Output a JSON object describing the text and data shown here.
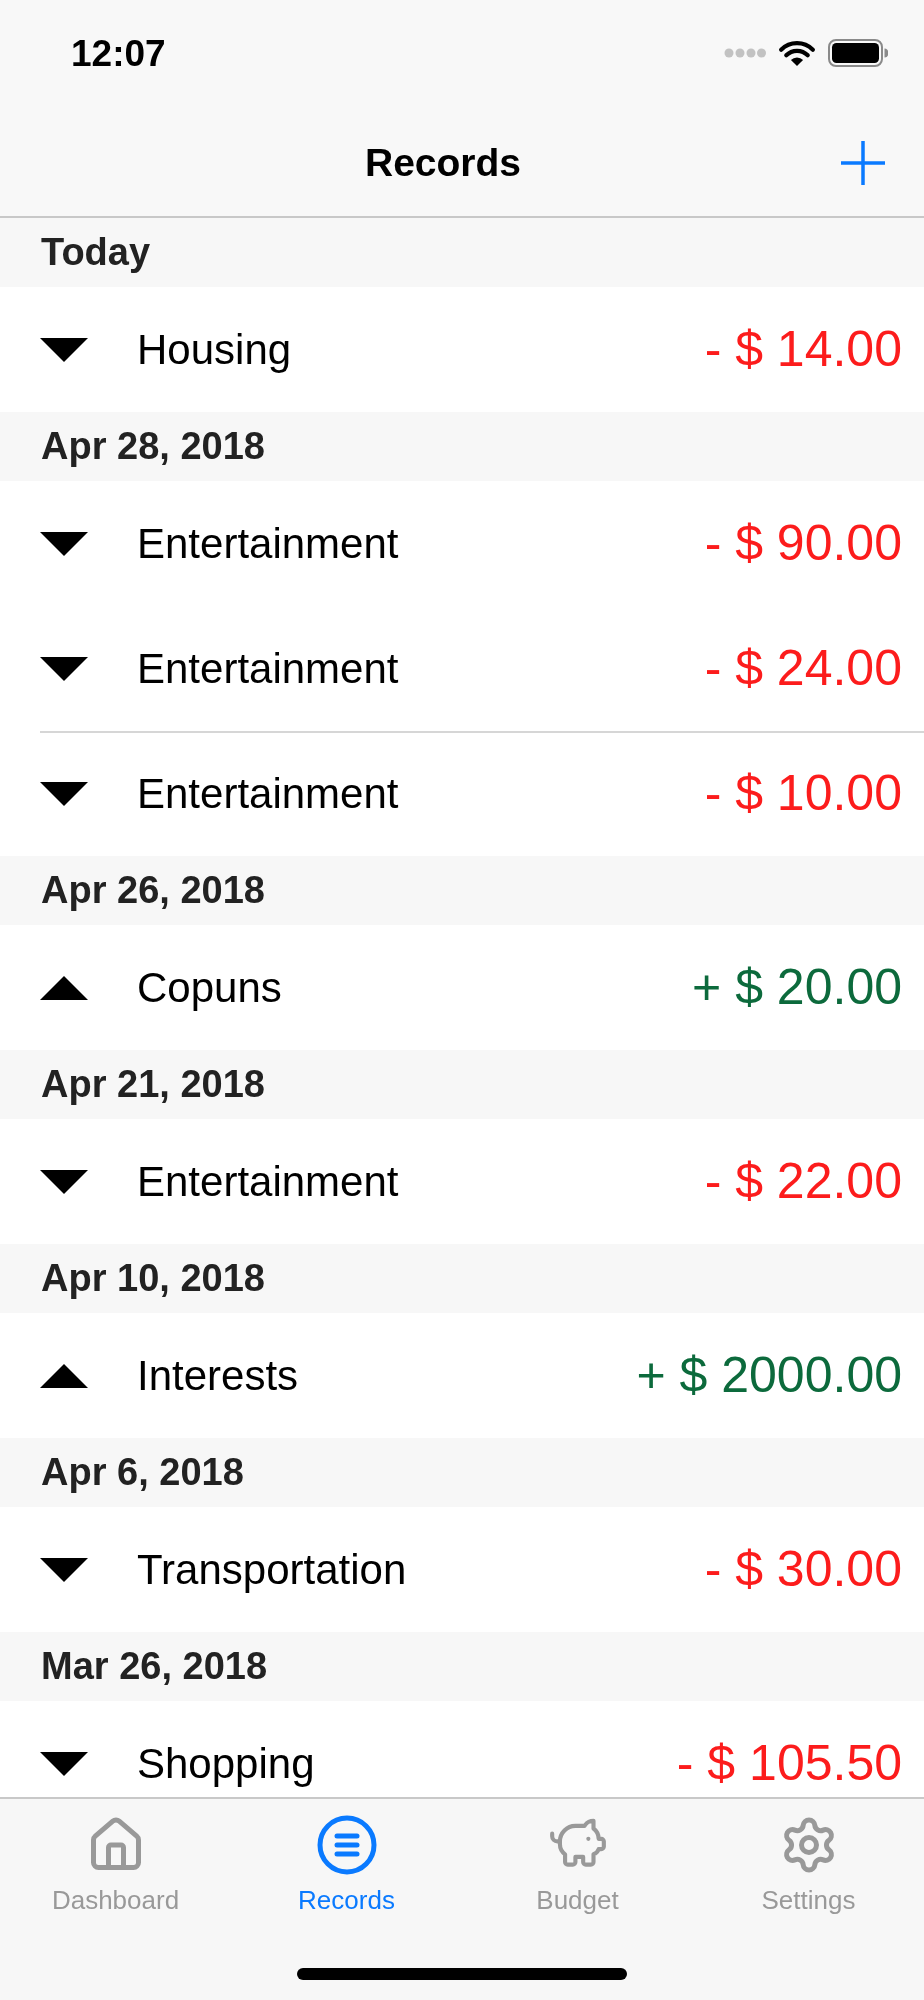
{
  "status_bar": {
    "time": "12:07"
  },
  "nav_bar": {
    "title": "Records"
  },
  "sections": [
    {
      "title": "Today",
      "records": [
        {
          "kind": "expense",
          "category": "Housing",
          "amount": "- $ 14.00",
          "separator_above": false
        }
      ]
    },
    {
      "title": "Apr 28, 2018",
      "records": [
        {
          "kind": "expense",
          "category": "Entertainment",
          "amount": "- $ 90.00",
          "separator_above": false
        },
        {
          "kind": "expense",
          "category": "Entertainment",
          "amount": "- $ 24.00",
          "separator_above": false
        },
        {
          "kind": "expense",
          "category": "Entertainment",
          "amount": "- $ 10.00",
          "separator_above": true
        }
      ]
    },
    {
      "title": "Apr 26, 2018",
      "records": [
        {
          "kind": "income",
          "category": "Copuns",
          "amount": "+ $ 20.00",
          "separator_above": false
        }
      ]
    },
    {
      "title": "Apr 21, 2018",
      "records": [
        {
          "kind": "expense",
          "category": "Entertainment",
          "amount": "- $ 22.00",
          "separator_above": false
        }
      ]
    },
    {
      "title": "Apr 10, 2018",
      "records": [
        {
          "kind": "income",
          "category": "Interests",
          "amount": "+ $ 2000.00",
          "separator_above": false
        }
      ]
    },
    {
      "title": "Apr 6, 2018",
      "records": [
        {
          "kind": "expense",
          "category": "Transportation",
          "amount": "- $ 30.00",
          "separator_above": false
        }
      ]
    },
    {
      "title": "Mar 26, 2018",
      "records": [
        {
          "kind": "expense",
          "category": "Shopping",
          "amount": "- $ 105.50",
          "separator_above": false
        }
      ]
    }
  ],
  "tab_bar": {
    "tabs": [
      {
        "label": "Dashboard",
        "selected": false
      },
      {
        "label": "Records",
        "selected": true
      },
      {
        "label": "Budget",
        "selected": false
      },
      {
        "label": "Settings",
        "selected": false
      }
    ]
  }
}
